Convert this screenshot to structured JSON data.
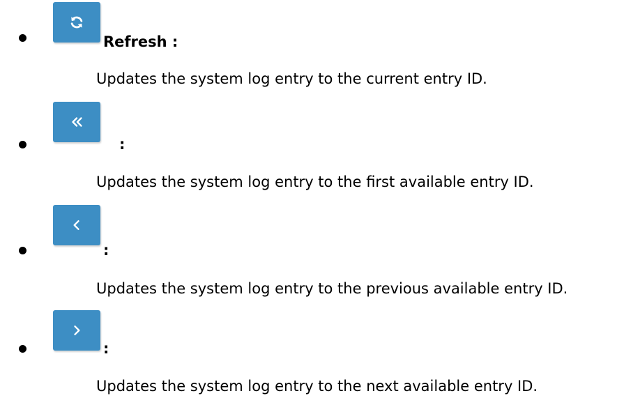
{
  "items": [
    {
      "icon": "refresh-icon",
      "title": "Refresh :",
      "description": "Updates the system log entry to the current entry ID."
    },
    {
      "icon": "double-chevron-left-icon",
      "title": ":",
      "description": "Updates the system log entry to the first available entry ID."
    },
    {
      "icon": "chevron-left-icon",
      "title": ":",
      "description": "Updates the system log entry to the previous available entry ID."
    },
    {
      "icon": "chevron-right-icon",
      "title": ":",
      "description": "Updates the system log entry to the next available entry ID."
    }
  ],
  "colors": {
    "button": "#3d8ec4",
    "icon": "#ffffff",
    "text": "#000000"
  }
}
